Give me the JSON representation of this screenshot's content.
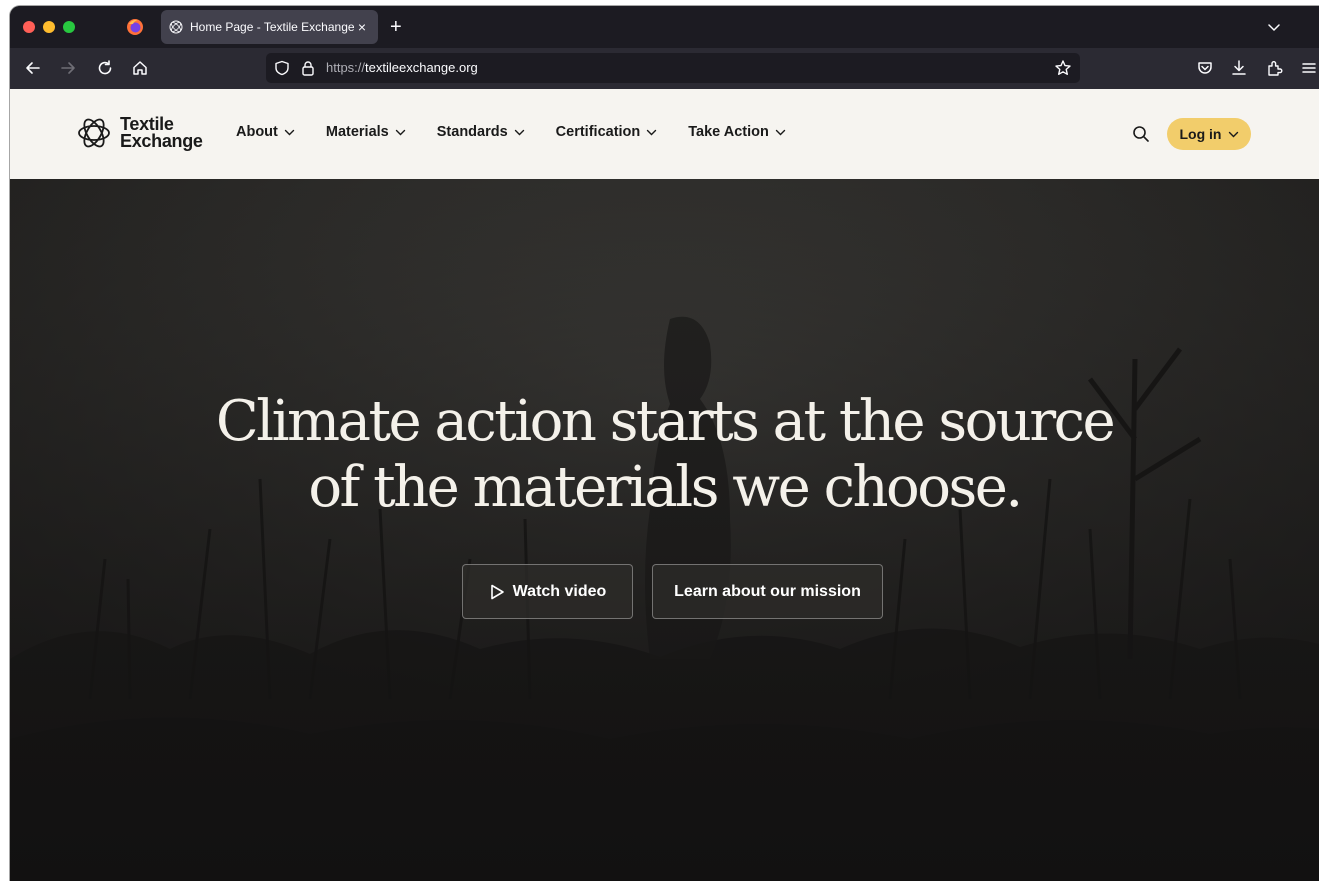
{
  "browser": {
    "tab_title": "Home Page - Textile Exchange",
    "tab_close": "×",
    "new_tab": "+",
    "url_scheme": "https://",
    "url_host": "textileexchange.org"
  },
  "site": {
    "logo_line1": "Textile",
    "logo_line2": "Exchange",
    "nav": [
      {
        "label": "About"
      },
      {
        "label": "Materials"
      },
      {
        "label": "Standards"
      },
      {
        "label": "Certification"
      },
      {
        "label": "Take Action"
      }
    ],
    "login_label": "Log in"
  },
  "hero": {
    "title_line1": "Climate action starts at the source",
    "title_line2": "of the materials we choose.",
    "watch_label": "Watch video",
    "mission_label": "Learn about our mission"
  },
  "colors": {
    "header_bg": "#f6f4f0",
    "login_bg": "#f2cd6b",
    "browser_chrome": "#1c1b22",
    "toolbar": "#2b2a33"
  },
  "icons": [
    "firefox-icon",
    "back-icon",
    "forward-icon",
    "reload-icon",
    "home-icon",
    "shield-icon",
    "lock-icon",
    "star-icon",
    "pocket-icon",
    "download-icon",
    "extensions-icon",
    "menu-icon",
    "search-icon",
    "play-icon",
    "chevron-down-icon"
  ]
}
